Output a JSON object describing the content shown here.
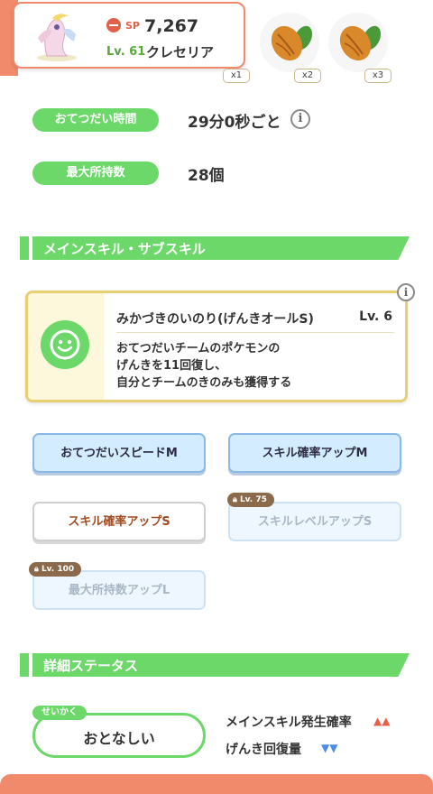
{
  "pokemon": {
    "sp_label": "SP",
    "sp_value": "7,267",
    "level": "Lv. 61",
    "name": "クレセリア"
  },
  "ingredients": [
    {
      "icon": "cacao-icon",
      "badge": "x1"
    },
    {
      "icon": "cacao-icon",
      "badge": "x2"
    },
    {
      "icon": "cacao-icon",
      "badge": "x3"
    }
  ],
  "stats": {
    "help_time_label": "おてつだい時間",
    "help_time_value": "29分0秒ごと",
    "max_carry_label": "最大所持数",
    "max_carry_value": "28個",
    "info_glyph": "i"
  },
  "skills_section": {
    "title": "メインスキル・サブスキル"
  },
  "main_skill": {
    "name": "みかづきのいのり(げんきオールS)",
    "level": "Lv. 6",
    "desc_line1": "おてつだいチームのポケモンの",
    "desc_line2": "げんきを11回復し、",
    "desc_line3": "自分とチームのきのみも獲得する"
  },
  "sub_skills": [
    {
      "label": "おてつだいスピードM",
      "style": "blue"
    },
    {
      "label": "スキル確率アップM",
      "style": "blue"
    },
    {
      "label": "スキル確率アップS",
      "style": "white"
    },
    {
      "label": "スキルレベルアップS",
      "style": "locked",
      "lock_level": "Lv. 75"
    },
    {
      "label": "最大所持数アップL",
      "style": "locked",
      "lock_level": "Lv. 100"
    }
  ],
  "details_section": {
    "title": "詳細ステータス"
  },
  "nature": {
    "tag": "せいかく",
    "value": "おとなしい",
    "up_effect": "メインスキル発生確率",
    "up_arrows": "▲▲",
    "down_effect": "げんき回復量",
    "down_arrows": "▼▼"
  },
  "colors": {
    "accent_green": "#6dd86a",
    "accent_orange": "#f08a6a",
    "skill_gold": "#e8cf72"
  }
}
